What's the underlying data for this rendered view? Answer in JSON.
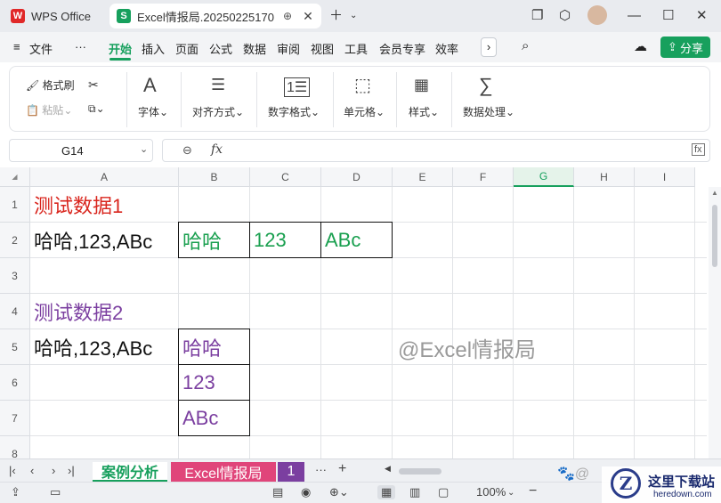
{
  "app": {
    "home_tab": "WPS Office",
    "doc_tab": "Excel情报局.20250225170",
    "menus": [
      "文件",
      "开始",
      "插入",
      "页面",
      "公式",
      "数据",
      "审阅",
      "视图",
      "工具",
      "会员专享",
      "效率"
    ],
    "share": "分享"
  },
  "ribbon": {
    "format_painter": "格式刷",
    "paste": "粘贴",
    "font": "字体",
    "align": "对齐方式",
    "number_format": "数字格式",
    "cells": "单元格",
    "styles": "样式",
    "data_process": "数据处理"
  },
  "formula_bar": {
    "cell_ref": "G14",
    "fx": "fx",
    "value": ""
  },
  "grid": {
    "columns": [
      "A",
      "B",
      "C",
      "D",
      "E",
      "F",
      "G",
      "H",
      "I"
    ],
    "rows": [
      "1",
      "2",
      "3",
      "4",
      "5",
      "6",
      "7",
      "8"
    ],
    "cells": {
      "A1": "测试数据1",
      "A2": "哈哈,123,ABc",
      "B2": "哈哈",
      "C2": "123",
      "D2": "ABc",
      "A4": "测试数据2",
      "A5": "哈哈,123,ABc",
      "B5": "哈哈",
      "B6": "123",
      "B7": "ABc"
    },
    "watermark": "@Excel情报局",
    "colors": {
      "title1": "#d9251d",
      "title2": "#7b3fa0",
      "green": "#1aa050",
      "purple": "#7b3fa0",
      "active_col": "#17a05d"
    }
  },
  "sheets": {
    "tabs": [
      "案例分析",
      "Excel情报局",
      "1"
    ],
    "more": "···",
    "add": "+"
  },
  "status": {
    "zoom": "100%"
  },
  "watermark_site": {
    "title": "这里下载站",
    "url": "heredown.com"
  }
}
